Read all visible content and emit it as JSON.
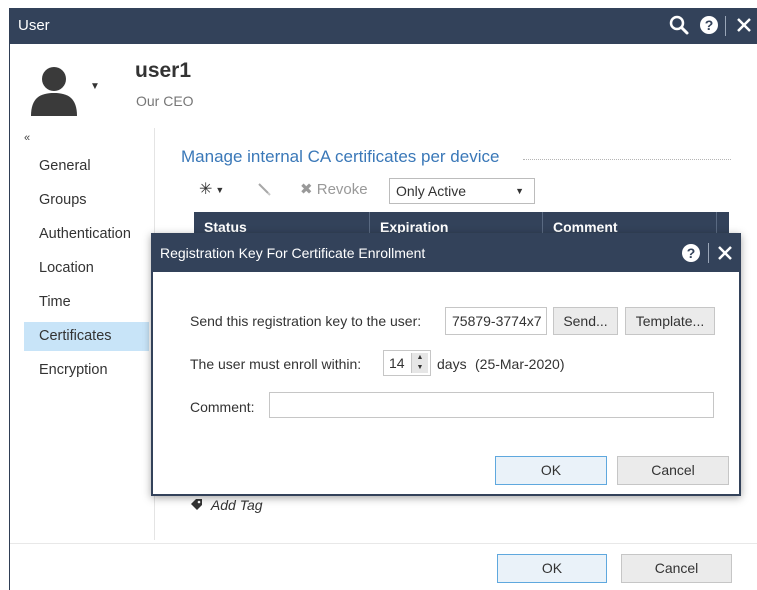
{
  "window": {
    "title": "User"
  },
  "user": {
    "name": "user1",
    "role": "Our CEO"
  },
  "sidebar": {
    "collapse_glyph": "«",
    "items": [
      {
        "label": "General"
      },
      {
        "label": "Groups"
      },
      {
        "label": "Authentication"
      },
      {
        "label": "Location"
      },
      {
        "label": "Time"
      },
      {
        "label": "Certificates",
        "active": true
      },
      {
        "label": "Encryption"
      }
    ]
  },
  "main": {
    "section_title": "Manage internal CA certificates per device",
    "toolbar": {
      "new_icon": "new-certificate-icon",
      "edit_icon": "pencil-icon",
      "revoke_label": "Revoke",
      "filter_value": "Only Active"
    },
    "table": {
      "columns": [
        "Status",
        "Expiration",
        "Comment"
      ]
    },
    "add_tag_label": "Add Tag"
  },
  "footer": {
    "ok_label": "OK",
    "cancel_label": "Cancel"
  },
  "dialog": {
    "title": "Registration Key For Certificate Enrollment",
    "send_label": "Send this registration key to the user:",
    "registration_key": "75879-3774x7",
    "send_button": "Send...",
    "template_button": "Template...",
    "enroll_label": "The user must enroll within:",
    "enroll_days": "14",
    "days_label": "days",
    "enroll_date": "(25-Mar-2020)",
    "comment_label": "Comment:",
    "comment_value": "",
    "ok_label": "OK",
    "cancel_label": "Cancel"
  },
  "colors": {
    "titlebar": "#33425a",
    "accent": "#3a78b8",
    "selected": "#c8e4f8"
  }
}
